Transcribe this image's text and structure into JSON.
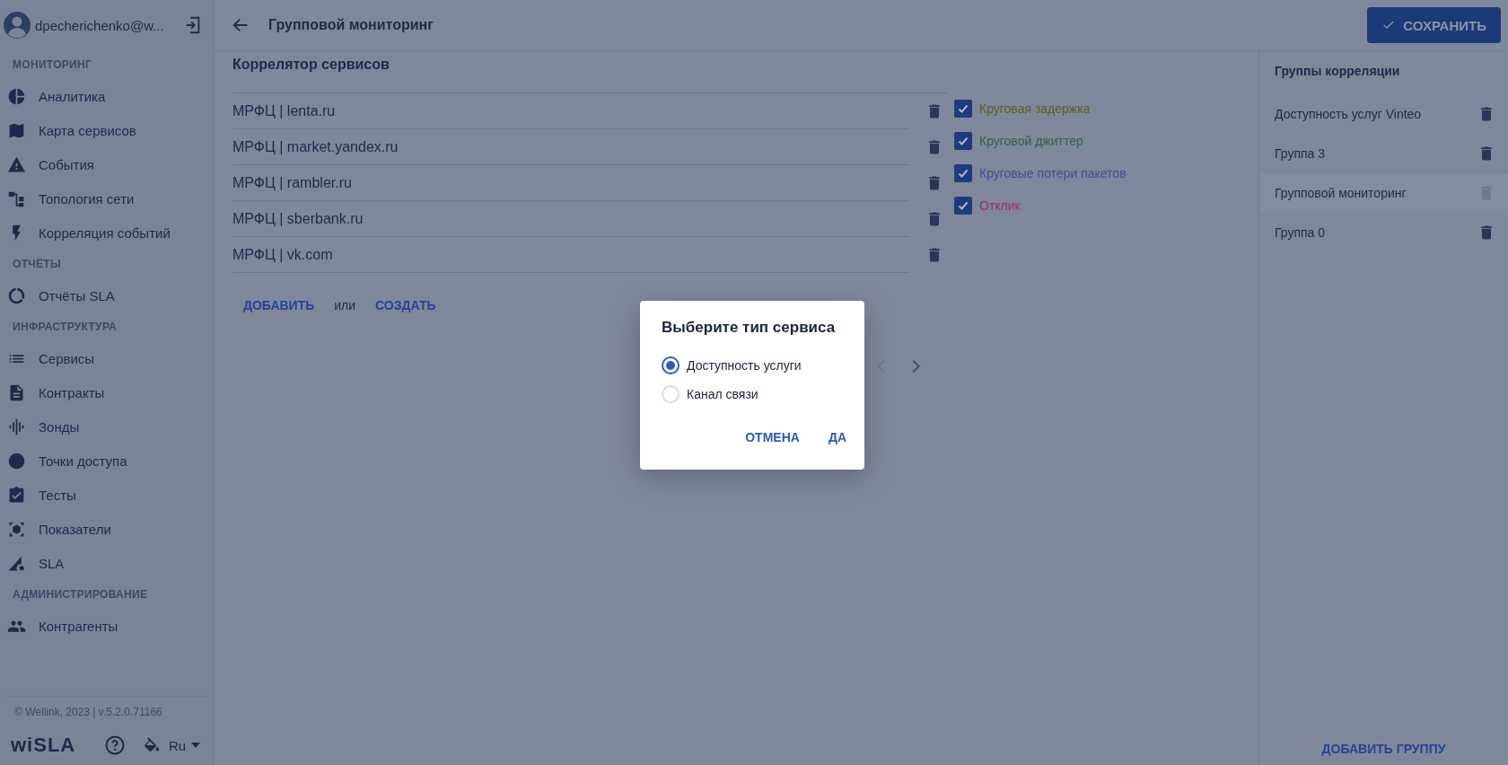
{
  "user": {
    "name": "dpecherichenko@w..."
  },
  "sidebar": {
    "sections": [
      {
        "title": "МОНИТОРИНГ",
        "items": [
          {
            "label": "Аналитика"
          },
          {
            "label": "Карта сервисов"
          },
          {
            "label": "События"
          },
          {
            "label": "Топология сети"
          },
          {
            "label": "Корреляция событий"
          }
        ]
      },
      {
        "title": "ОТЧЁТЫ",
        "items": [
          {
            "label": "Отчёты SLA"
          }
        ]
      },
      {
        "title": "ИНФРАСТРУКТУРА",
        "items": [
          {
            "label": "Сервисы"
          },
          {
            "label": "Контракты"
          },
          {
            "label": "Зонды"
          },
          {
            "label": "Точки доступа"
          },
          {
            "label": "Тесты"
          },
          {
            "label": "Показатели"
          },
          {
            "label": "SLA"
          }
        ]
      },
      {
        "title": "АДМИНИСТРИРОВАНИЕ",
        "items": [
          {
            "label": "Контрагенты"
          }
        ]
      }
    ]
  },
  "footer": {
    "copyright": "© Wellink, 2023 | v.5.2.0.71166",
    "logo": "wiSLA",
    "language": "Ru"
  },
  "header": {
    "title": "Групповой мониторинг",
    "save_button": "СОХРАНИТЬ"
  },
  "correlator": {
    "title": "Коррелятор сервисов",
    "services": [
      "МРФЦ | lenta.ru",
      "МРФЦ | market.yandex.ru",
      "МРФЦ | rambler.ru",
      "МРФЦ | sberbank.ru",
      "МРФЦ | vk.com"
    ],
    "metrics": [
      {
        "label": "Круговая задержка",
        "checked": true,
        "color": "#5e5e1c"
      },
      {
        "label": "Круговой джиттер",
        "checked": true,
        "color": "#2d6446"
      },
      {
        "label": "Круговые потери пакетов",
        "checked": true,
        "color": "#3f4aa0"
      },
      {
        "label": "Отклик",
        "checked": true,
        "color": "#a02a72"
      }
    ],
    "add_link": "ДОБАВИТЬ",
    "or_text": "или",
    "create_link": "СОЗДАТЬ",
    "pager": {
      "prev_disabled": true,
      "next_disabled": false
    }
  },
  "groups": {
    "title": "Группы корреляции",
    "items": [
      {
        "name": "Доступность услуг Vinteo",
        "selected": false
      },
      {
        "name": "Группа 3",
        "selected": false
      },
      {
        "name": "Групповой мониторинг",
        "selected": true
      },
      {
        "name": "Группа 0",
        "selected": false
      }
    ],
    "add_button": "ДОБАВИТЬ ГРУППУ"
  },
  "dialog": {
    "title": "Выберите тип сервиса",
    "options": [
      {
        "label": "Доступность услуги",
        "selected": true
      },
      {
        "label": "Канал связи",
        "selected": false
      }
    ],
    "buttons": [
      "ОТМЕНА",
      "ДА"
    ]
  }
}
